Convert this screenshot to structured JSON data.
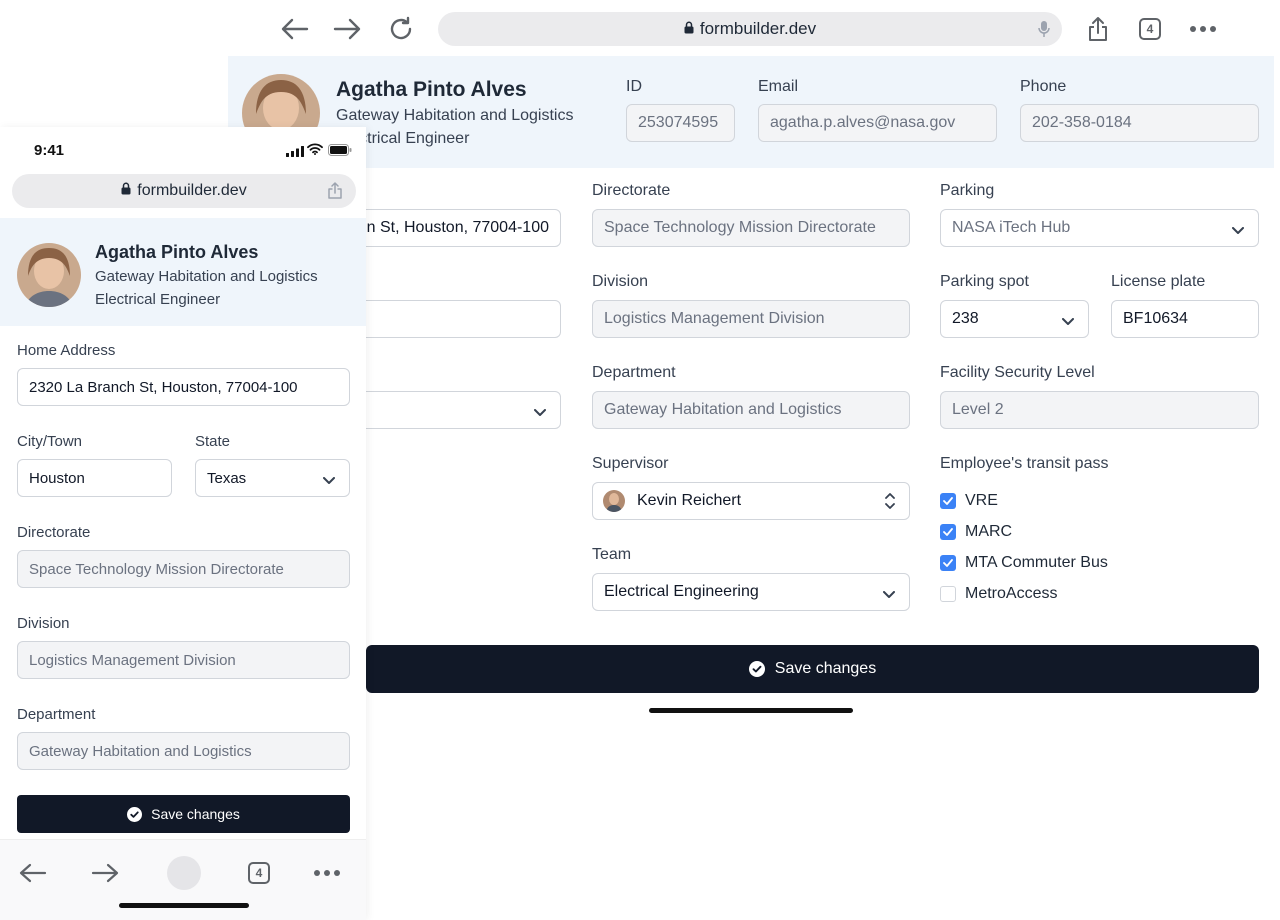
{
  "browser": {
    "url": "formbuilder.dev",
    "tab_count": "4"
  },
  "profile": {
    "name": "Agatha Pinto Alves",
    "organization": "Gateway Habitation and Logistics",
    "title": "Electrical Engineer",
    "title_cropped": "trical Engineer",
    "id_label": "ID",
    "id_value": "253074595",
    "email_label": "Email",
    "email_value": "agatha.p.alves@nasa.gov",
    "phone_label": "Phone",
    "phone_value": "202-358-0184"
  },
  "form": {
    "home_address_label": "Home Address",
    "home_address_value": "2320 La Branch St, Houston, 77004-100",
    "home_address_cropped": "n St, Houston, 77004-100",
    "city_label": "City/Town",
    "city_value": "Houston",
    "state_label": "State",
    "state_value": "Texas",
    "directorate_label": "Directorate",
    "directorate_value": "Space Technology Mission Directorate",
    "division_label": "Division",
    "division_value": "Logistics Management Division",
    "department_label": "Department",
    "department_value": "Gateway Habitation and Logistics",
    "supervisor_label": "Supervisor",
    "supervisor_value": "Kevin Reichert",
    "team_label": "Team",
    "team_value": "Electrical Engineering",
    "parking_label": "Parking",
    "parking_value": "NASA iTech Hub",
    "parking_spot_label": "Parking spot",
    "parking_spot_value": "238",
    "license_plate_label": "License plate",
    "license_plate_value": "BF10634",
    "security_level_label": "Facility Security Level",
    "security_level_value": "Level 2",
    "transit_label": "Employee's transit pass",
    "transit_options": [
      {
        "label": "VRE",
        "checked": true
      },
      {
        "label": "MARC",
        "checked": true
      },
      {
        "label": "MTA Commuter Bus",
        "checked": true
      },
      {
        "label": "MetroAccess",
        "checked": false
      }
    ],
    "save_label": "Save changes"
  },
  "phone": {
    "time": "9:41"
  },
  "colors": {
    "header_bg": "#eff5fb",
    "save_bg": "#111827",
    "checkbox_on": "#3b82f6"
  }
}
